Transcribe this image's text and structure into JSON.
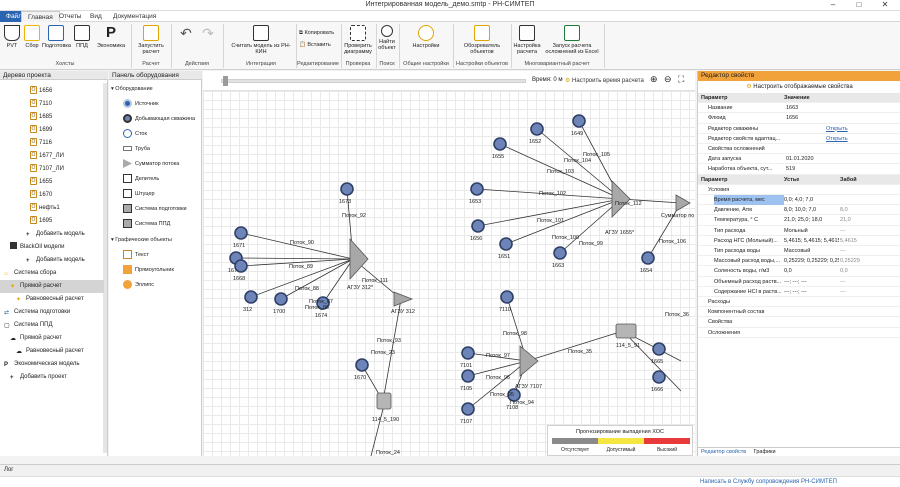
{
  "window": {
    "title": "Интегрированная модель_демо.smtp - РН-СИМТЕП"
  },
  "menu": {
    "tabs": [
      "Файл",
      "Главная",
      "Отчеты",
      "Вид",
      "Документация"
    ]
  },
  "ribbon": {
    "buttons": {
      "pvt": "PVT",
      "sbor": "Сбор",
      "podgotovka": "Подготовка",
      "ppd": "ППД",
      "economics": "Экономика",
      "run": "Запустить расчет",
      "read": "Считать модель из РН-КИН",
      "copy": "Копировать",
      "paste": "Вставить",
      "check": "Проверить диаграмму",
      "find": "Найти объект",
      "settings": "Настройки",
      "browser": "Обозреватель объектов",
      "calcsettings": "Настройка расчета",
      "multirun": "Запуск расчета осложнений из Excel"
    },
    "groups": [
      "Холсты",
      "Расчет",
      "Действия",
      "Интеграция",
      "Редактирование",
      "Проверка",
      "Поиск",
      "Общие настройки",
      "Настройки объектов",
      "Многовариантный расчет"
    ]
  },
  "tree": {
    "title": "Дерево проекта",
    "wells": [
      "1656",
      "7110",
      "1685",
      "1699",
      "7116",
      "1677_ЛИ",
      "7107_ЛИ",
      "1655",
      "1670",
      "нефть1",
      "1695"
    ],
    "add_model": "Добавить модель",
    "blackoil": "BlackOil модели",
    "add_model2": "Добавить модель",
    "sbor": "Система сбора",
    "direct": "Прямой расчет",
    "equil": "Равновесный расчет",
    "prep": "Система подготовки",
    "ppd": "Система ППД",
    "direct2": "Прямой расчет",
    "equil2": "Равновесный расчет",
    "econ": "Экономическая модель",
    "add_project": "Добавить проект"
  },
  "equipment": {
    "title": "Панель оборудования",
    "section1": "Оборудование",
    "items": [
      "Источник",
      "Добывающая скважина",
      "Сток",
      "Труба",
      "Сумматор потока",
      "Делитель",
      "Штуцер",
      "Система подготовки",
      "Система ППД"
    ],
    "section2": "Графические объекты",
    "graphic": [
      "Текст",
      "Прямоугольник",
      "Эллипс"
    ]
  },
  "canvas": {
    "time_label": "Время: 0 мес",
    "time_button": "Настроить время расчета",
    "nodes": [
      "1678",
      "1673",
      "1671",
      "1668",
      "312",
      "1700",
      "1674",
      "1670",
      "1652",
      "1649",
      "1655",
      "1653",
      "1656",
      "1651",
      "1663",
      "1654",
      "7110",
      "7101",
      "7105",
      "7107",
      "7108",
      "1665",
      "1666"
    ],
    "streams": [
      "Поток_92",
      "Поток_90",
      "Поток_89",
      "Поток_88",
      "Поток_87",
      "Поток_86",
      "Поток_111",
      "Поток_93",
      "Поток_23",
      "Поток_24",
      "Поток_105",
      "Поток_104",
      "Поток_103",
      "Поток_102",
      "Поток_101",
      "Поток_100",
      "Поток_99",
      "Поток_112",
      "Поток_106",
      "Поток_98",
      "Поток_97",
      "Поток_96",
      "Поток_95",
      "Поток_94",
      "Поток_35",
      "Поток_36"
    ],
    "units": [
      "АГЗУ 312*",
      "АГЗУ 312",
      "114_5_190",
      "АГЗУ 1655*",
      "Сумматор по",
      "АГЗУ 7107",
      "114_5_91"
    ],
    "legend": {
      "title": "Прогнозирование выпадения ХОС",
      "absent": "Отсутствует",
      "allowed": "Допустимый",
      "high": "Высокий",
      "colors": [
        "#8a8a8a",
        "#f5e642",
        "#e83a3a"
      ]
    }
  },
  "props": {
    "title": "Редактор свойств",
    "setup": "Настроить отображаемые свойства",
    "h_param": "Параметр",
    "h_value": "Значение",
    "rows": [
      [
        "Название",
        "1663"
      ],
      [
        "Флюид",
        "1656"
      ],
      [
        "Редактор скважины",
        "Открыть"
      ],
      [
        "Редактор свойств адаптац...",
        "Открыть"
      ],
      [
        "Свойства осложнений",
        ""
      ],
      [
        "Дата запуска",
        "01.01.2020"
      ],
      [
        "Наработка объекта, сут...",
        "519"
      ]
    ],
    "h_param2": "Параметр",
    "h_inlet": "Устье",
    "h_bottom": "Забой",
    "cond": "Условия",
    "rows2": [
      [
        "Время расчета, мес",
        "0,0; 4,0; 7,0",
        ""
      ],
      [
        "Давление, Атм",
        "8,0; 10,0; 7,0",
        "8,0"
      ],
      [
        "Температура, ° С",
        "21,0; 25,0; 18,0",
        "21,0"
      ],
      [
        "Тип расхода",
        "Мольный",
        "---"
      ],
      [
        "Расход НГС (Мольный)...",
        "5,4615; 5,4615; 5,4615",
        "5,4615"
      ],
      [
        "Тип расхода воды",
        "Массовый",
        "---"
      ],
      [
        "Массовый расход воды,...",
        "0,25229; 0,25229; 0,252...",
        "0,25229"
      ],
      [
        "Соленость воды, г/м3",
        "0,0",
        "0,0"
      ],
      [
        "Объемный расход раств...",
        "---; ---; ---",
        "---"
      ],
      [
        "Содержание HCl в раств...",
        "---; ---; ---",
        "---"
      ]
    ],
    "sections": [
      "Расходы",
      "Компонентный состав",
      "Свойства",
      "Осложнения"
    ],
    "tab1": "Редактор свойств",
    "tab2": "Графики"
  },
  "log": "Лог",
  "support": "Написать в Службу сопровождения РН-СИМТЕП"
}
